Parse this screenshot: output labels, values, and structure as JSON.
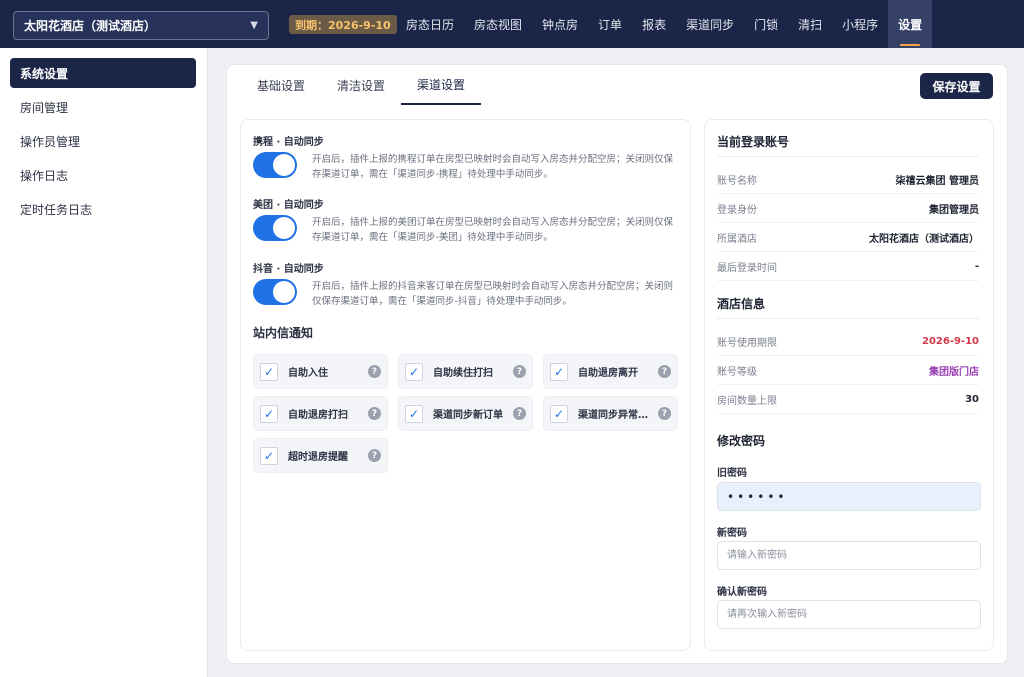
{
  "header": {
    "hotel_name": "太阳花酒店（测试酒店）",
    "expire_label": "到期：2026-9-10",
    "nav": [
      "房态日历",
      "房态视图",
      "钟点房",
      "订单",
      "报表",
      "渠道同步",
      "门锁",
      "清扫",
      "小程序",
      "设置"
    ],
    "active_nav": "设置"
  },
  "sidebar": {
    "items": [
      "系统设置",
      "房间管理",
      "操作员管理",
      "操作日志",
      "定时任务日志"
    ]
  },
  "tabs": [
    "基础设置",
    "清洁设置",
    "渠道设置"
  ],
  "save_label": "保存设置",
  "sync": [
    {
      "title": "携程 · 自动同步",
      "enabled": true,
      "desc": "开启后，插件上报的携程订单在房型已映射时会自动写入房态并分配空房；关闭则仅保存渠道订单，需在「渠道同步-携程」待处理中手动同步。"
    },
    {
      "title": "美团 · 自动同步",
      "enabled": true,
      "desc": "开启后，插件上报的美团订单在房型已映射时会自动写入房态并分配空房；关闭则仅保存渠道订单，需在「渠道同步-美团」待处理中手动同步。"
    },
    {
      "title": "抖音 · 自动同步",
      "enabled": true,
      "desc": "开启后，插件上报的抖音来客订单在房型已映射时会自动写入房态并分配空房；关闭则仅保存渠道订单，需在「渠道同步-抖音」待处理中手动同步。"
    }
  ],
  "notify": {
    "title": "站内信通知",
    "items": [
      "自助入住",
      "自助续住打扫",
      "自助退房离开",
      "自助退房打扫",
      "渠道同步新订单",
      "渠道同步异常提醒",
      "超时退房提醒"
    ]
  },
  "account": {
    "title": "当前登录账号",
    "rows": [
      {
        "k": "账号名称",
        "v": "柒禧云集团 管理员"
      },
      {
        "k": "登录身份",
        "v": "集团管理员"
      },
      {
        "k": "所属酒店",
        "v": "太阳花酒店（测试酒店）"
      },
      {
        "k": "最后登录时间",
        "v": "-"
      }
    ]
  },
  "hotel_info": {
    "title": "酒店信息",
    "rows": [
      {
        "k": "账号使用期限",
        "v": "2026-9-10",
        "color": "#d2394b"
      },
      {
        "k": "账号等级",
        "v": "集团版门店",
        "color": "#9a3fb4"
      },
      {
        "k": "房间数量上限",
        "v": "30"
      }
    ]
  },
  "password": {
    "title": "修改密码",
    "old_label": "旧密码",
    "old_value": "••••••",
    "new_label": "新密码",
    "new_placeholder": "请输入新密码",
    "confirm_label": "确认新密码",
    "confirm_placeholder": "请再次输入新密码"
  }
}
